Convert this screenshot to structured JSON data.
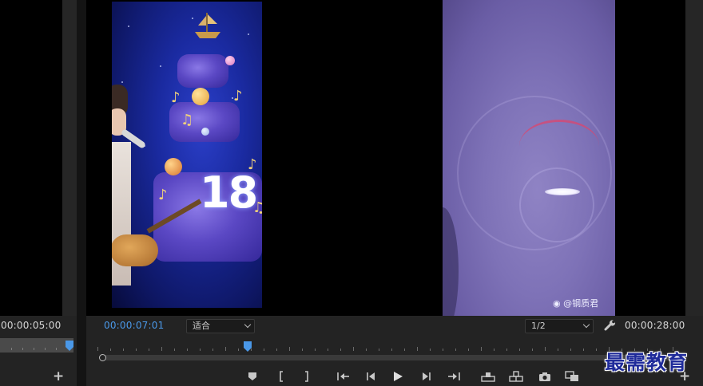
{
  "source_monitor": {
    "timecode": "00:00:05:00",
    "add_label": "+"
  },
  "program_monitor": {
    "timecode": "00:00:07:01",
    "zoom_value": "适合",
    "resolution_value": "1/2",
    "duration": "00:00:28:00",
    "add_label": "+",
    "clip_cake_number": "18",
    "clip_watermark": "@钢质君"
  },
  "transport_controls": [
    {
      "name": "add-marker-icon"
    },
    {
      "name": "mark-in-icon"
    },
    {
      "name": "mark-out-icon"
    },
    {
      "name": "go-to-in-icon"
    },
    {
      "name": "step-back-icon"
    },
    {
      "name": "play-icon"
    },
    {
      "name": "step-forward-icon"
    },
    {
      "name": "go-to-out-icon"
    },
    {
      "name": "lift-icon"
    },
    {
      "name": "extract-icon"
    },
    {
      "name": "export-frame-icon"
    },
    {
      "name": "comparison-view-icon"
    }
  ],
  "brand_watermark": "最需教育",
  "colors": {
    "timecode_accent": "#4a98e8",
    "playhead": "#4a98e8",
    "panel_bg": "#232323"
  }
}
